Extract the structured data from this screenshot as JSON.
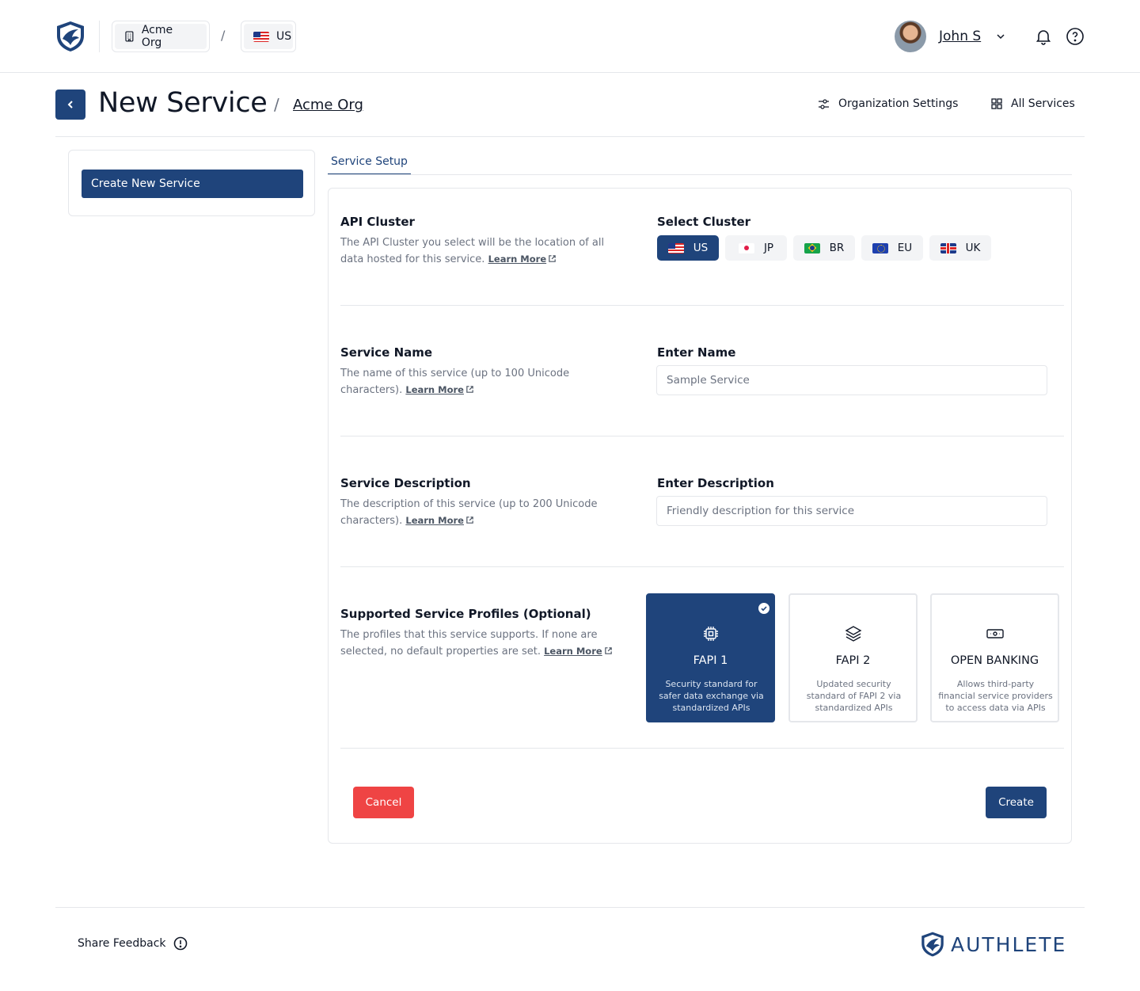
{
  "header": {
    "org_chip": "Acme Org",
    "crumb_separator": "/",
    "region_chip": "US",
    "user_name": "John S"
  },
  "title_bar": {
    "title": "New Service",
    "separator": "/",
    "org_link": "Acme Org",
    "org_settings": "Organization Settings",
    "all_services": "All Services"
  },
  "sidebar": {
    "items": [
      {
        "label": "Create New Service",
        "active": true
      }
    ]
  },
  "tabs": [
    {
      "label": "Service Setup",
      "active": true
    }
  ],
  "form": {
    "learn_more": "Learn More",
    "api_cluster": {
      "title": "API Cluster",
      "description": "The API Cluster you select will be the location of all data hosted for this service.",
      "field_title": "Select Cluster",
      "options": [
        {
          "label": "US",
          "flag": "us-flag-icon",
          "selected": true
        },
        {
          "label": "JP",
          "flag": "jp-flag-icon",
          "selected": false
        },
        {
          "label": "BR",
          "flag": "br-flag-icon",
          "selected": false
        },
        {
          "label": "EU",
          "flag": "eu-flag-icon",
          "selected": false
        },
        {
          "label": "UK",
          "flag": "uk-flag-icon",
          "selected": false
        }
      ]
    },
    "service_name": {
      "title": "Service Name",
      "description": "The name of this service (up to 100 Unicode characters).",
      "field_title": "Enter Name",
      "value": "",
      "placeholder": "Sample Service"
    },
    "service_description": {
      "title": "Service Description",
      "description": "The description of this service (up to 200 Unicode characters).",
      "field_title": "Enter Description",
      "value": "",
      "placeholder": "Friendly description for this service"
    },
    "profiles": {
      "title": "Supported Service Profiles (Optional)",
      "description": "The profiles that this service supports. If none are selected, no default properties are set.",
      "items": [
        {
          "name": "FAPI 1",
          "description": "Security standard for safer data exchange via standardized APIs",
          "icon": "chip-icon",
          "selected": true
        },
        {
          "name": "FAPI 2",
          "description": "Updated security standard of FAPI 2 via standardized APIs",
          "icon": "layers-icon",
          "selected": false
        },
        {
          "name": "OPEN BANKING",
          "description": "Allows third-party financial service providers to access data via APIs",
          "icon": "banknote-icon",
          "selected": false
        }
      ]
    },
    "cancel_label": "Cancel",
    "create_label": "Create"
  },
  "footer": {
    "feedback": "Share Feedback",
    "brand": "AUTHLETE"
  },
  "colors": {
    "primary": "#1f447b",
    "danger": "#ef4444",
    "muted_text": "#6b7280",
    "border": "#e5e7eb"
  }
}
